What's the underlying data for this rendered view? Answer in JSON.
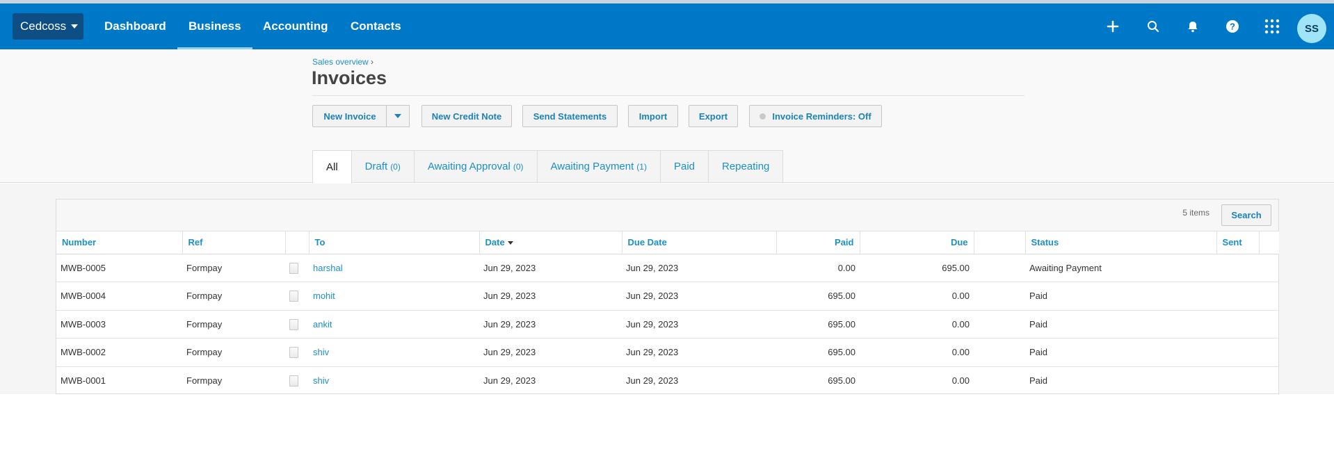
{
  "nav": {
    "org": "Cedcoss",
    "links": [
      "Dashboard",
      "Business",
      "Accounting",
      "Contacts"
    ],
    "active": "Business",
    "avatar": "SS",
    "icons": [
      "plus-icon",
      "search-icon",
      "bell-icon",
      "help-icon",
      "apps-grid-icon"
    ]
  },
  "header": {
    "breadcrumb": "Sales overview",
    "breadcrumb_sep": "›",
    "title": "Invoices"
  },
  "actions": {
    "new_invoice": "New Invoice",
    "new_credit_note": "New Credit Note",
    "send_statements": "Send Statements",
    "import": "Import",
    "export": "Export",
    "reminders": "Invoice Reminders: Off"
  },
  "tabs": [
    {
      "label": "All",
      "count": ""
    },
    {
      "label": "Draft",
      "count": "(0)"
    },
    {
      "label": "Awaiting Approval",
      "count": "(0)"
    },
    {
      "label": "Awaiting Payment",
      "count": "(1)"
    },
    {
      "label": "Paid",
      "count": ""
    },
    {
      "label": "Repeating",
      "count": ""
    }
  ],
  "table": {
    "items_count": "5 items",
    "search_label": "Search",
    "columns": {
      "number": "Number",
      "ref": "Ref",
      "to": "To",
      "date": "Date",
      "due_date": "Due Date",
      "paid": "Paid",
      "due": "Due",
      "status": "Status",
      "sent": "Sent"
    },
    "rows": [
      {
        "number": "MWB-0005",
        "ref": "Formpay",
        "to": "harshal",
        "date": "Jun 29, 2023",
        "due_date": "Jun 29, 2023",
        "paid": "0.00",
        "due": "695.00",
        "status": "Awaiting Payment"
      },
      {
        "number": "MWB-0004",
        "ref": "Formpay",
        "to": "mohit",
        "date": "Jun 29, 2023",
        "due_date": "Jun 29, 2023",
        "paid": "695.00",
        "due": "0.00",
        "status": "Paid"
      },
      {
        "number": "MWB-0003",
        "ref": "Formpay",
        "to": "ankit",
        "date": "Jun 29, 2023",
        "due_date": "Jun 29, 2023",
        "paid": "695.00",
        "due": "0.00",
        "status": "Paid"
      },
      {
        "number": "MWB-0002",
        "ref": "Formpay",
        "to": "shiv",
        "date": "Jun 29, 2023",
        "due_date": "Jun 29, 2023",
        "paid": "695.00",
        "due": "0.00",
        "status": "Paid"
      },
      {
        "number": "MWB-0001",
        "ref": "Formpay",
        "to": "shiv",
        "date": "Jun 29, 2023",
        "due_date": "Jun 29, 2023",
        "paid": "695.00",
        "due": "0.00",
        "status": "Paid"
      }
    ]
  },
  "colors": {
    "nav_bg": "#0078c8",
    "org_bg": "#0d4f85",
    "link": "#1c8fc7",
    "avatar_bg": "#9fe5f7"
  }
}
